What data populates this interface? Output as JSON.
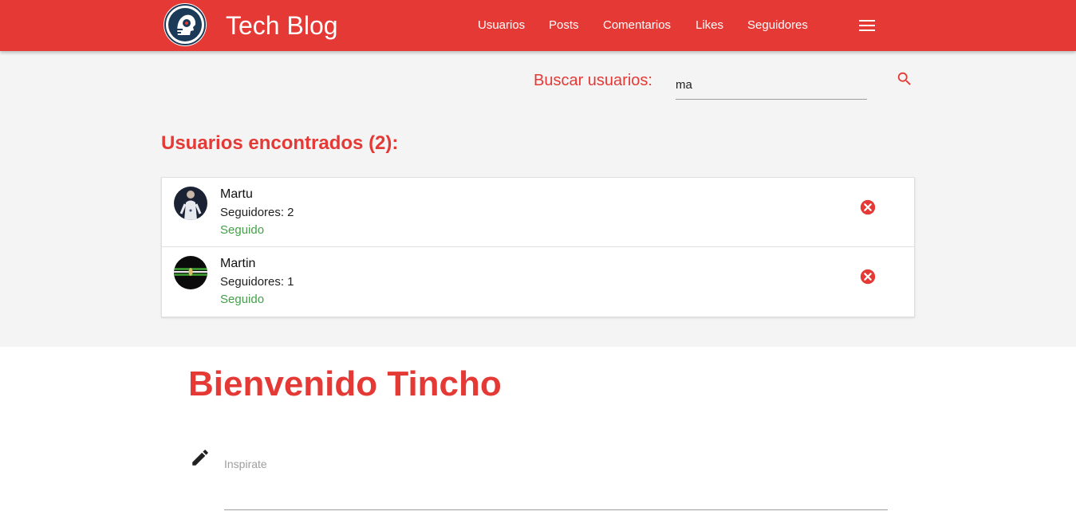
{
  "navbar": {
    "brand": "Tech Blog",
    "links": [
      {
        "label": "Usuarios"
      },
      {
        "label": "Posts"
      },
      {
        "label": "Comentarios"
      },
      {
        "label": "Likes"
      },
      {
        "label": "Seguidores"
      }
    ]
  },
  "search": {
    "label": "Buscar usuarios:",
    "value": "ma"
  },
  "results": {
    "title": "Usuarios encontrados (2):",
    "followers_label": "Seguidores:",
    "items": [
      {
        "name": "Martu",
        "followers": "2",
        "status": "Seguido"
      },
      {
        "name": "Martin",
        "followers": "1",
        "status": "Seguido"
      }
    ]
  },
  "welcome": {
    "title": "Bienvenido Tincho"
  },
  "post": {
    "placeholder": "Inspirate"
  },
  "colors": {
    "primary": "#e53935",
    "success": "#43a047",
    "background": "#f4f4f4"
  },
  "icons": {
    "logo": "tech-head-logo",
    "menu": "hamburger-icon",
    "search": "search-icon",
    "remove": "close-circle-icon",
    "edit": "pencil-icon"
  }
}
